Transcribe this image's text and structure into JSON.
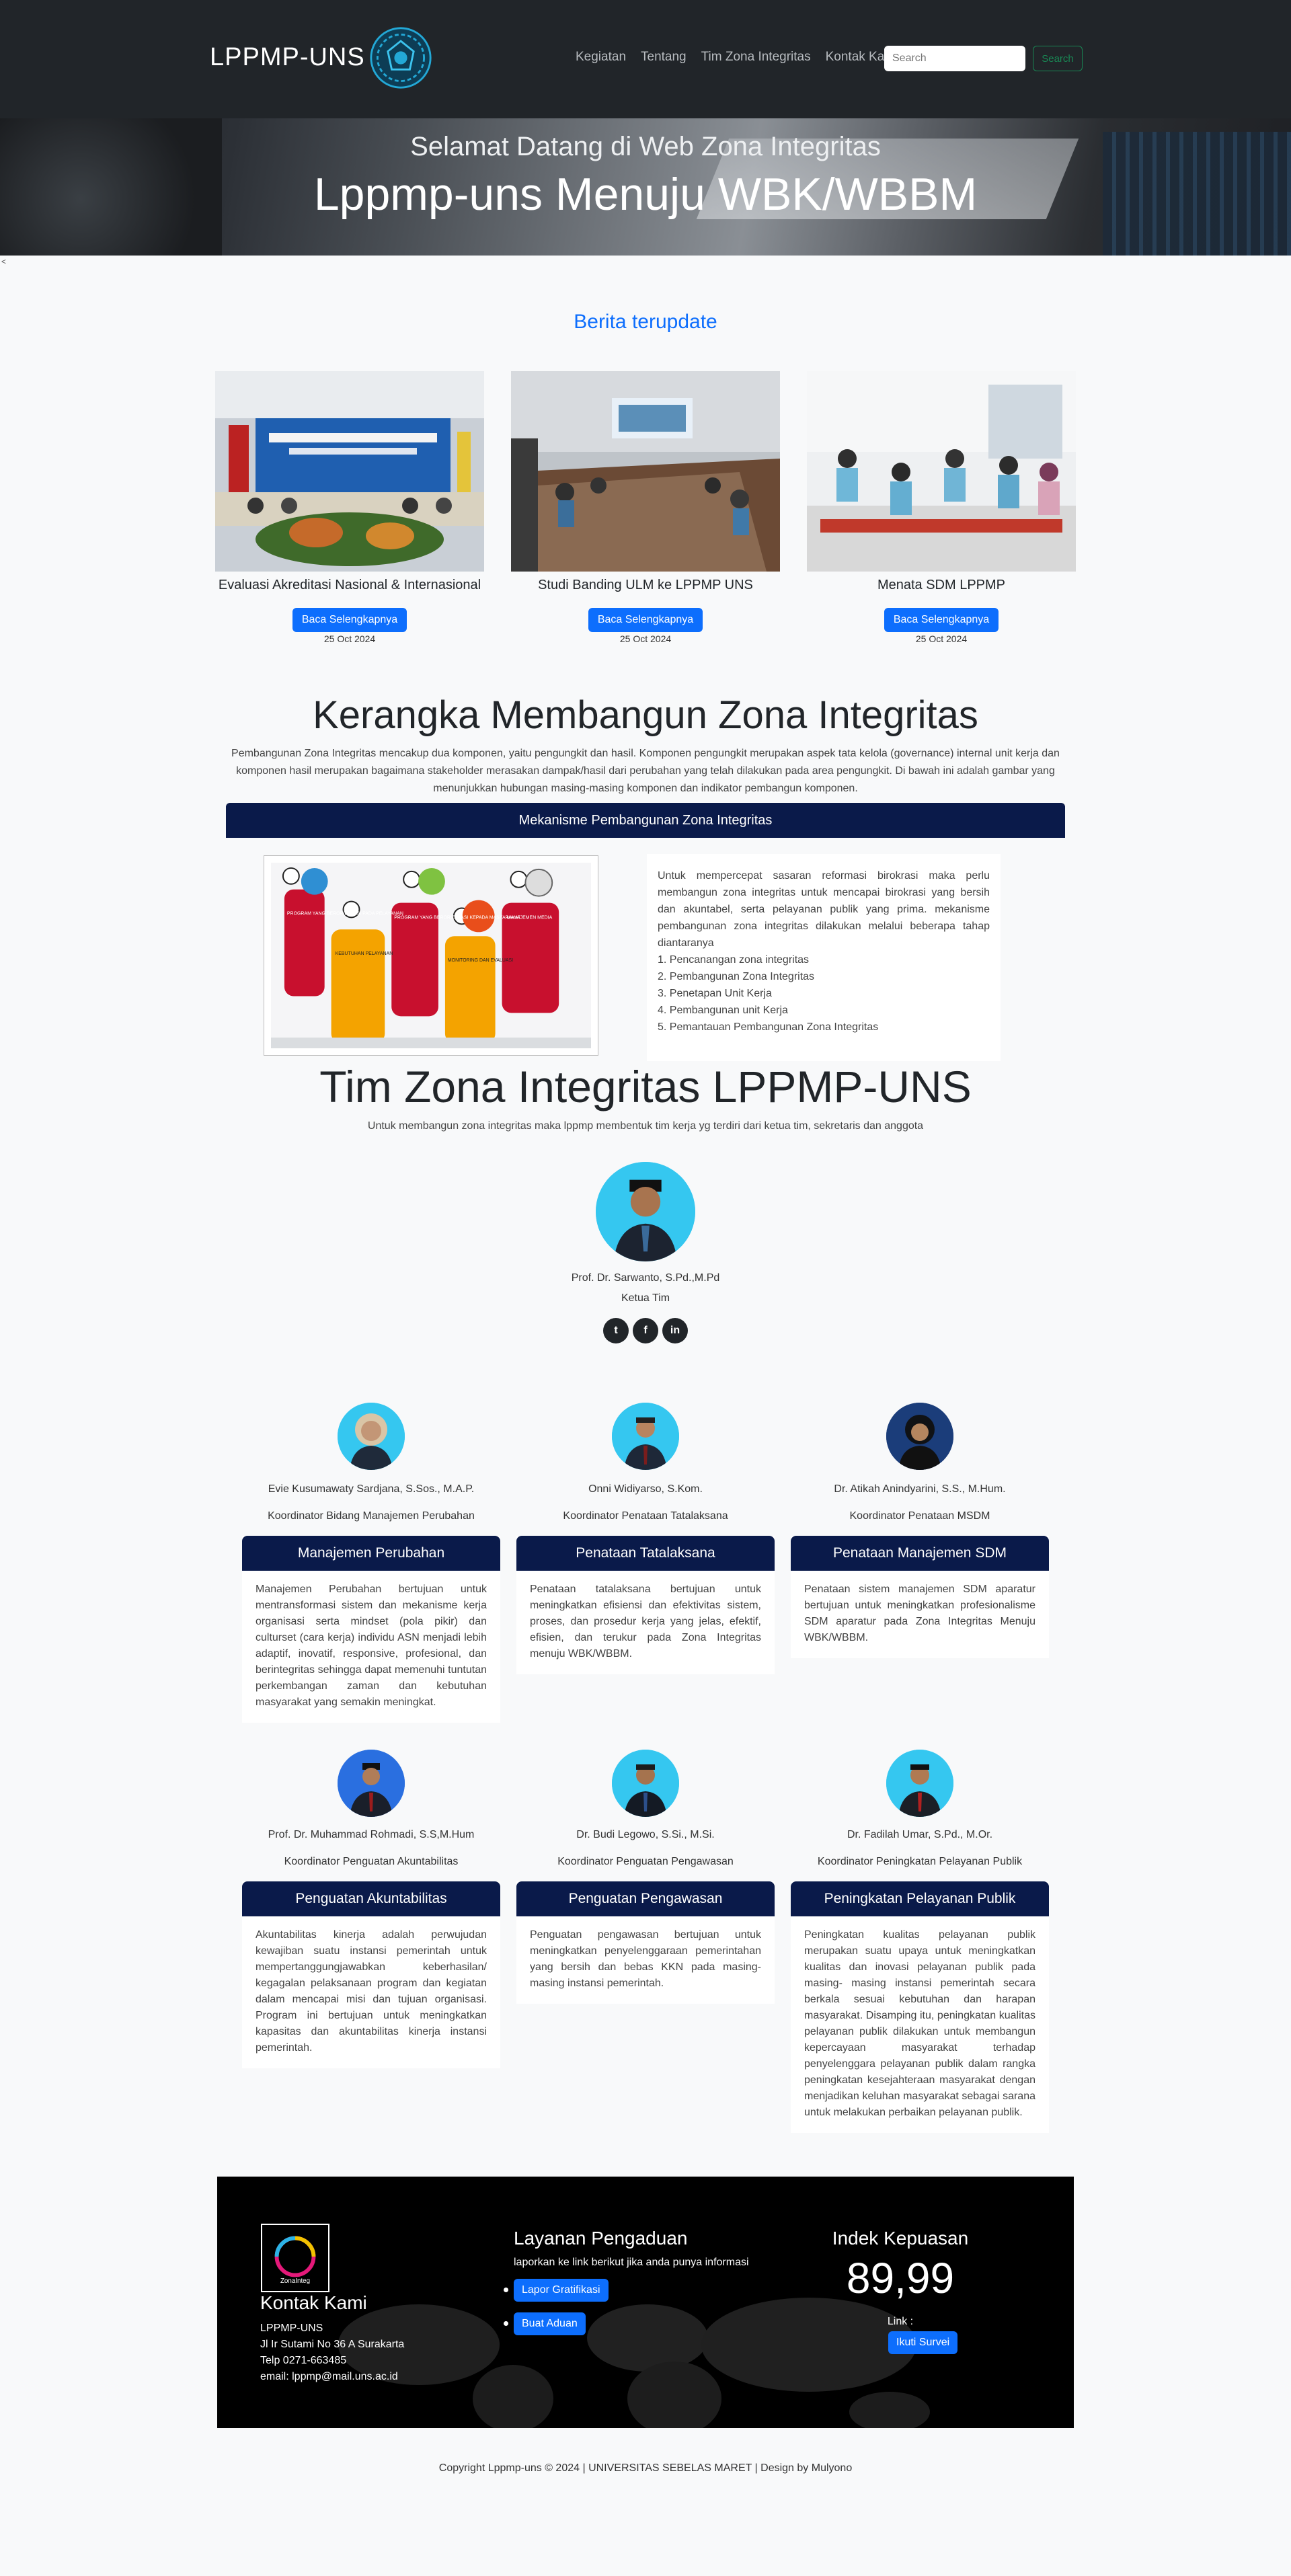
{
  "nav": {
    "brand": "LPPMP-UNS",
    "menu": [
      "Kegiatan",
      "Tentang",
      "Tim Zona Integritas",
      "Kontak Kami"
    ],
    "search_placeholder": "Search",
    "search_button": "Search"
  },
  "hero": {
    "subtitle": "Selamat Datang di Web Zona Integritas",
    "title": "Lppmp-uns Menuju WBK/WBBM"
  },
  "stray_char": "<",
  "news": {
    "title": "Berita terupdate",
    "items": [
      {
        "caption": "Evaluasi Akreditasi Nasional & Internasional",
        "button": "Baca Selengkapnya",
        "date": "25 Oct 2024"
      },
      {
        "caption": "Studi Banding ULM ke LPPMP UNS",
        "button": "Baca Selengkapnya",
        "date": "25 Oct 2024"
      },
      {
        "caption": "Menata SDM LPPMP",
        "button": "Baca Selengkapnya",
        "date": "25 Oct 2024"
      }
    ]
  },
  "kerangka": {
    "title": "Kerangka Membangun Zona Integritas",
    "description": "Pembangunan Zona Integritas mencakup dua komponen, yaitu pengungkit dan hasil. Komponen pengungkit merupakan aspek tata kelola (governance) internal unit kerja dan komponen hasil merupakan bagaimana stakeholder merasakan dampak/hasil dari perubahan yang telah dilakukan pada area pengungkit. Di bawah ini adalah gambar yang menunjukkan hubungan masing-masing komponen dan indikator pembangun komponen.",
    "bar_title": "Mekanisme Pembangunan Zona Integritas",
    "info_labels": [
      "PROGRAM YANG BERORIENTASI PADA PELAYANAN",
      "KEBUTUHAN PELAYANAN",
      "PROGRAM YANG BERORIENTASI KEPADA MASYARAKAT",
      "MONITORING DAN EVALUASI",
      "MANAJEMEN MEDIA"
    ],
    "mechanism_intro": "Untuk mempercepat sasaran reformasi birokrasi maka perlu membangun zona integritas untuk mencapai birokrasi yang bersih dan akuntabel, serta pelayanan publik yang prima. mekanisme pembangunan zona integritas dilakukan melalui beberapa tahap diantaranya",
    "steps": [
      "1. Pencanangan zona integritas",
      "2. Pembangunan Zona Integritas",
      "3. Penetapan Unit Kerja",
      "4. Pembangunan unit Kerja",
      "5. Pemantauan Pembangunan Zona Integritas"
    ]
  },
  "team": {
    "title": "Tim Zona Integritas LPPMP-UNS",
    "subtitle": "Untuk membangun zona integritas maka lppmp membentuk tim kerja yg terdiri dari ketua tim, sekretaris dan anggota",
    "leader": {
      "name": "Prof. Dr. Sarwanto, S.Pd.,M.Pd",
      "role": "Ketua Tim"
    },
    "social": [
      "twitter-icon",
      "facebook-icon",
      "linkedin-icon"
    ],
    "members": [
      {
        "name": "Evie Kusumawaty Sardjana, S.Sos., M.A.P.",
        "role": "Koordinator Bidang Manajemen Perubahan",
        "card_title": "Manajemen Perubahan",
        "card_text": "Manajemen Perubahan bertujuan untuk mentransformasi sistem dan mekanisme kerja organisasi serta mindset (pola pikir) dan culturset (cara kerja) individu ASN menjadi lebih adaptif, inovatif, responsive, profesional, dan berintegritas sehingga dapat memenuhi tuntutan perkembangan zaman dan kebutuhan masyarakat yang semakin meningkat."
      },
      {
        "name": "Onni Widiyarso, S.Kom.",
        "role": "Koordinator Penataan Tatalaksana",
        "card_title": "Penataan Tatalaksana",
        "card_text": "Penataan tatalaksana bertujuan untuk meningkatkan efisiensi dan efektivitas sistem, proses, dan prosedur kerja yang jelas, efektif, efisien, dan terukur pada Zona Integritas menuju WBK/WBBM."
      },
      {
        "name": "Dr. Atikah Anindyarini, S.S., M.Hum.",
        "role": "Koordinator Penataan MSDM",
        "card_title": "Penataan Manajemen SDM",
        "card_text": "Penataan sistem manajemen SDM aparatur bertujuan untuk meningkatkan profesionalisme SDM aparatur pada Zona Integritas Menuju WBK/WBBM."
      },
      {
        "name": "Prof. Dr. Muhammad Rohmadi, S.S,M.Hum",
        "role": "Koordinator Penguatan Akuntabilitas",
        "card_title": "Penguatan Akuntabilitas",
        "card_text": "Akuntabilitas kinerja adalah perwujudan kewajiban suatu instansi pemerintah untuk mempertanggungjawabkan keberhasilan/ kegagalan pelaksanaan program dan kegiatan dalam mencapai misi dan tujuan organisasi. Program ini bertujuan untuk meningkatkan kapasitas dan akuntabilitas kinerja instansi pemerintah."
      },
      {
        "name": "Dr. Budi Legowo, S.Si., M.Si.",
        "role": "Koordinator Penguatan Pengawasan",
        "card_title": "Penguatan Pengawasan",
        "card_text": "Penguatan pengawasan bertujuan untuk meningkatkan penyelenggaraan pemerintahan yang bersih dan bebas KKN pada masing-masing instansi pemerintah."
      },
      {
        "name": "Dr. Fadilah Umar, S.Pd., M.Or.",
        "role": "Koordinator Peningkatan Pelayanan Publik",
        "card_title": "Peningkatan Pelayanan Publik",
        "card_text": "Peningkatan kualitas pelayanan publik merupakan suatu upaya untuk meningkatkan kualitas dan inovasi pelayanan publik pada masing- masing instansi pemerintah secara berkala sesuai kebutuhan dan harapan masyarakat. Disamping itu, peningkatan kualitas pelayanan publik dilakukan untuk membangun kepercayaan masyarakat terhadap penyelenggara pelayanan publik dalam rangka peningkatan kesejahteraan masyarakat dengan menjadikan keluhan masyarakat sebagai sarana untuk melakukan perbaikan pelayanan publik."
      }
    ]
  },
  "footer": {
    "logo_text": "ZonaInteg",
    "contact_title": "Kontak Kami",
    "contact_lines": [
      "LPPMP-UNS",
      "Jl Ir Sutami No 36 A Surakarta",
      "Telp 0271-663485",
      "email: lppmp@mail.uns.ac.id"
    ],
    "service_title": "Layanan Pengaduan",
    "service_sub": "laporkan ke link berikut jika anda punya informasi",
    "service_buttons": [
      "Lapor Gratifikasi",
      "Buat Aduan"
    ],
    "index_title": "Indek Kepuasan",
    "index_value": "89,99",
    "link_label": "Link :",
    "survey_button": "Ikuti Survei"
  },
  "copyright": "Copyright Lppmp-uns © 2024 | UNIVERSITAS SEBELAS MARET | Design by Mulyono",
  "colors": {
    "nav_bg": "#212529",
    "primary": "#0d6efd",
    "navy": "#0a1a4a",
    "success": "#198754"
  }
}
